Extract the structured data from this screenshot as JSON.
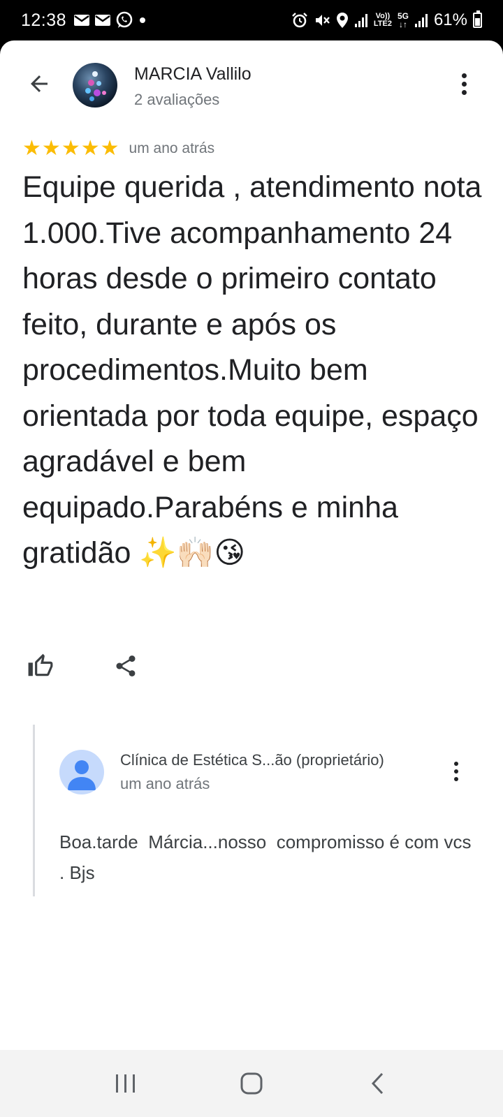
{
  "status_bar": {
    "time": "12:38",
    "battery": "61%",
    "network_label": "LTE2",
    "network_5g": "5G",
    "volte": "Vo))",
    "left_icons": [
      "mail-icon",
      "mail-icon",
      "whatsapp-icon",
      "dot-icon"
    ],
    "right_icons": [
      "alarm-icon",
      "mute-icon",
      "location-icon",
      "signal-icon",
      "signal-icon",
      "battery-icon"
    ]
  },
  "header": {
    "back_icon": "arrow-back-icon",
    "user_name": "MARCIA Vallilo",
    "user_reviews": "2 avaliações",
    "more_icon": "more-vert-icon"
  },
  "review": {
    "rating": 5,
    "max_rating": 5,
    "star_color": "#fbbc04",
    "date": "um ano atrás",
    "text": "Equipe querida , atendimento nota 1.000.Tive acompanhamento 24 horas desde o primeiro contato feito, durante e após os procedimentos.Muito bem orientada por toda equipe, espaço agradável e bem equipado.Parabéns e minha gratidão ✨🙌🏻😘"
  },
  "actions": {
    "like_icon": "thumb-up-icon",
    "share_icon": "share-icon"
  },
  "reply": {
    "owner_name": "Clínica de Estética S...ão (proprietário)",
    "date": "um ano atrás",
    "text": "Boa.tarde  Márcia...nosso  compromisso é com vcs . Bjs",
    "avatar_color": "#c6dafc",
    "avatar_icon_color": "#4285f4"
  },
  "nav_bar": {
    "recent_icon": "recent-apps-icon",
    "home_icon": "home-icon",
    "back_icon": "nav-back-icon"
  }
}
